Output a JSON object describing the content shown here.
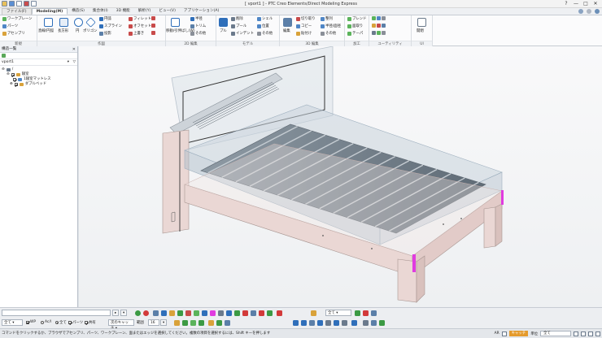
{
  "window": {
    "title": "[ vport1 ] - PTC Creo Elements/Direct Modeling Express",
    "controls": [
      "?",
      "—",
      "□",
      "✕"
    ]
  },
  "tabs": [
    "ファイル(F)",
    "Modeling(M)",
    "構造(S)",
    "集合体(I)",
    "3D 機能",
    "解析(Y)",
    "ビュー(V)",
    "アプリケーション(A)"
  ],
  "ribbon": {
    "groups": [
      "新規",
      "作図",
      "2D 編集",
      "モデル",
      "3D 編集",
      "加工",
      "ユーティリティ",
      "UI"
    ],
    "new": [
      "ワークプレーン",
      "パーツ",
      "アセンブリ"
    ],
    "draw_big": [
      "直線/円弧",
      "長方形",
      "円",
      "ポリゴン"
    ],
    "draw_small": [
      "円弧",
      "スプライン",
      "投影",
      "フィレット",
      "オフセット",
      "上書き"
    ],
    "edit2d": [
      "移動/引伸ばし(W)",
      "半径",
      "トリム",
      "その他"
    ],
    "model_big": "プル",
    "model": [
      "削除",
      "プール",
      "インデント",
      "シェル",
      "位置",
      "その他"
    ],
    "edit3d_big": "編集",
    "edit3d": [
      "切り取り",
      "コピー",
      "貼付け",
      "整列",
      "半径/面径",
      "その他"
    ],
    "machining": [
      "ブレンド",
      "面取り",
      "テーパ"
    ],
    "util_big": "複雑化",
    "ui_big": "開閉"
  },
  "panel": {
    "title": "構造一覧",
    "vport": "vport1",
    "tree": [
      {
        "label": "/",
        "level": 0
      },
      {
        "label": "寝室",
        "level": 1
      },
      {
        "label": "1寝室マットレス",
        "level": 2
      },
      {
        "label": "ダブルベッド",
        "level": 2
      }
    ]
  },
  "bottom": {
    "select_all": "全て",
    "opt_wp": "WP",
    "opt_all_assy": "Ac/l",
    "opt_all": "全て",
    "opt_parts": "パーツ",
    "opt_shared": "共有",
    "mode_select": "次のキャッチ",
    "zoom_label": "範囲",
    "zoom_value": "16",
    "right_select": "全て"
  },
  "status": {
    "message": "コマンドをクリックするか、ブラウザでアセンブリ、パーツ、ワークプレーン、面またはエッジを選択してください。複数の項目を選択するには、Shift キーを押します",
    "mode": "AR",
    "badge": "キャッチ",
    "unit_label": "単位",
    "unit_value": "全て"
  },
  "colors": {
    "accent": "#2f6fba",
    "highlight": "#e03be0",
    "wood": "#ead7d4",
    "glass": "#9bb0c2"
  }
}
